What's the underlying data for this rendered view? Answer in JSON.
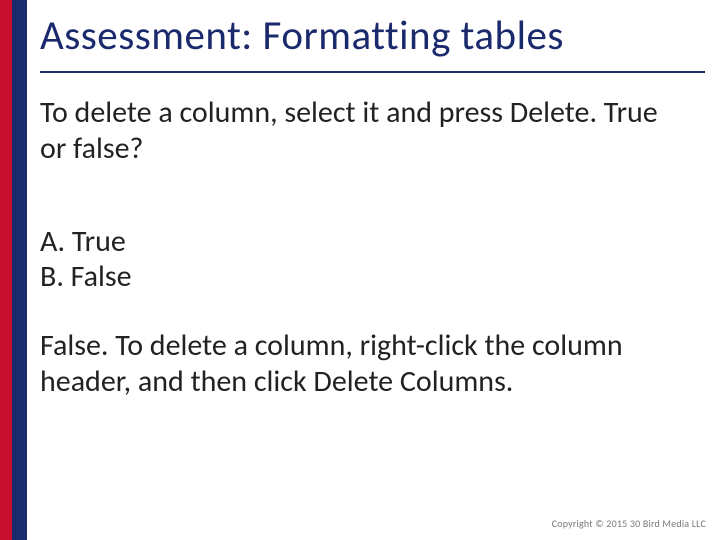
{
  "title": "Assessment: Formatting tables",
  "question": "To delete a column, select it and press Delete. True or false?",
  "options": {
    "a": "A. True",
    "b": "B. False"
  },
  "answer": "False. To delete a column, right-click the column header, and then click Delete Columns.",
  "copyright": "Copyright © 2015 30 Bird Media LLC"
}
